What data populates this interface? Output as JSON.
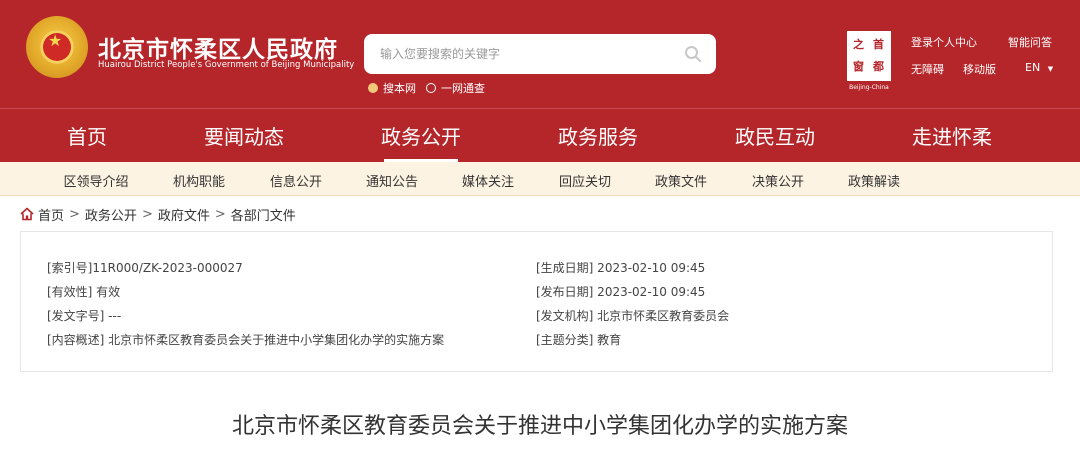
{
  "site": {
    "title_cn": "北京市怀柔区人民政府",
    "title_en": "Huairou District People's Government of Beijing Municipality"
  },
  "search": {
    "placeholder": "输入您要搜索的关键字",
    "scopes": [
      {
        "label": "搜本网",
        "selected": true
      },
      {
        "label": "一网通查",
        "selected": false
      }
    ]
  },
  "stamp": {
    "chars": [
      "首",
      "都",
      "之",
      "窗"
    ],
    "en": "Beijing-China"
  },
  "utility": {
    "login": "登录个人中心",
    "smart_qa": "智能问答",
    "accessibility": "无障碍",
    "mobile": "移动版",
    "lang": "EN",
    "lang_caret": "▼"
  },
  "main_nav": [
    {
      "label": "首页",
      "active": false
    },
    {
      "label": "要闻动态",
      "active": false
    },
    {
      "label": "政务公开",
      "active": true
    },
    {
      "label": "政务服务",
      "active": false
    },
    {
      "label": "政民互动",
      "active": false
    },
    {
      "label": "走进怀柔",
      "active": false
    }
  ],
  "sub_nav": [
    "区领导介绍",
    "机构职能",
    "信息公开",
    "通知公告",
    "媒体关注",
    "回应关切",
    "政策文件",
    "决策公开",
    "政策解读"
  ],
  "breadcrumb": [
    "首页",
    "政务公开",
    "政府文件",
    "各部门文件"
  ],
  "breadcrumb_sep": ">",
  "meta": {
    "index_no": "[索引号]11R000/ZK-2023-000027",
    "validity": "[有效性] 有效",
    "doc_no": "[发文字号] ---",
    "summary": "[内容概述] 北京市怀柔区教育委员会关于推进中小学集团化办学的实施方案",
    "created": "[生成日期] 2023-02-10 09:45",
    "published": "[发布日期] 2023-02-10 09:45",
    "issuer": "[发文机构] 北京市怀柔区教育委员会",
    "category": "[主题分类] 教育"
  },
  "document_title": "北京市怀柔区教育委员会关于推进中小学集团化办学的实施方案",
  "colors": {
    "brand_red": "#b5262b",
    "subnav_bg": "#fdf3e2",
    "accent_gold": "#f0c97a"
  }
}
